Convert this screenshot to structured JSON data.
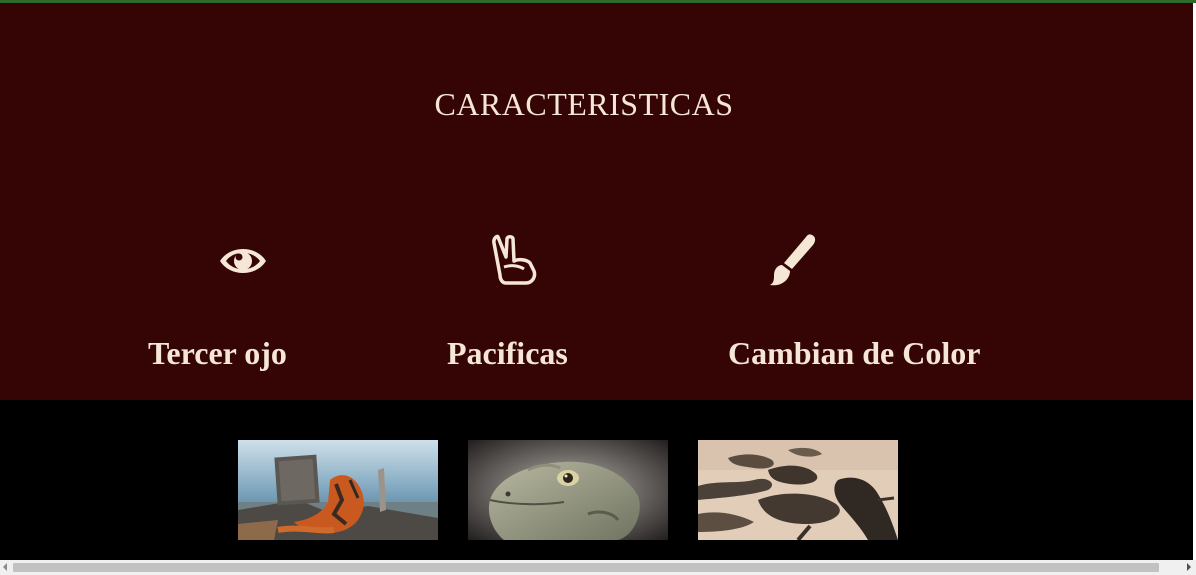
{
  "features_section": {
    "title": "CARACTERISTICAS",
    "items": [
      {
        "label": "Tercer ojo",
        "icon": "eye-icon"
      },
      {
        "label": "Pacificas",
        "icon": "peace-hand-icon"
      },
      {
        "label": "Cambian de Color",
        "icon": "paint-brush-icon"
      }
    ]
  },
  "gallery": {
    "photos": [
      {
        "subject": "orange-iguana-by-water"
      },
      {
        "subject": "iguana-head-closeup"
      },
      {
        "subject": "iguanas-on-sand"
      }
    ]
  },
  "colors": {
    "section_bg": "#350506",
    "text": "#f6e6d6",
    "gallery_bg": "#000000",
    "top_border": "#2e6b2a"
  }
}
